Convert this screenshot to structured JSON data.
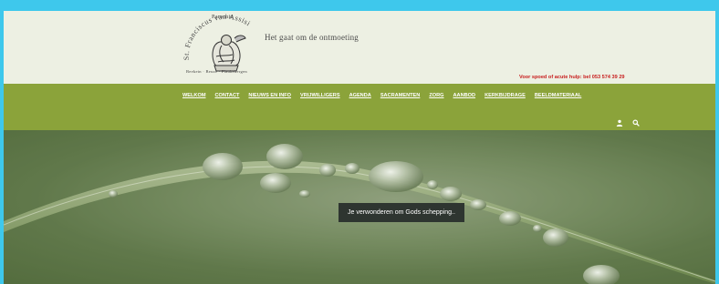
{
  "header": {
    "parochie": "Parochie",
    "logo_text": "St. Franciscus van Assisi",
    "places": "Beekein · Beuze · Flaukebergen",
    "tagline": "Het gaat om de ontmoeting",
    "helpline": "Voor spoed of acute hulp: bel 053 574 39 29"
  },
  "nav": {
    "items": [
      {
        "label": "WELKOM"
      },
      {
        "label": "CONTACT"
      },
      {
        "label": "NIEUWS EN INFO"
      },
      {
        "label": "VRIJWILLIGERS"
      },
      {
        "label": "AGENDA"
      },
      {
        "label": "SACRAMENTEN"
      },
      {
        "label": "ZORG"
      },
      {
        "label": "AANBOD"
      },
      {
        "label": "KERKBIJDRAGE"
      },
      {
        "label": "BEELDMATERIAAL"
      }
    ],
    "icons": [
      "user-icon",
      "search-icon"
    ]
  },
  "hero": {
    "caption": "Je verwonderen om Gods schepping.."
  },
  "colors": {
    "frame": "#3ec8ec",
    "header_bg": "#edf0e3",
    "nav_bg": "#8ba33a",
    "helpline": "#c81e1e",
    "caption_bg": "#2e3530"
  }
}
